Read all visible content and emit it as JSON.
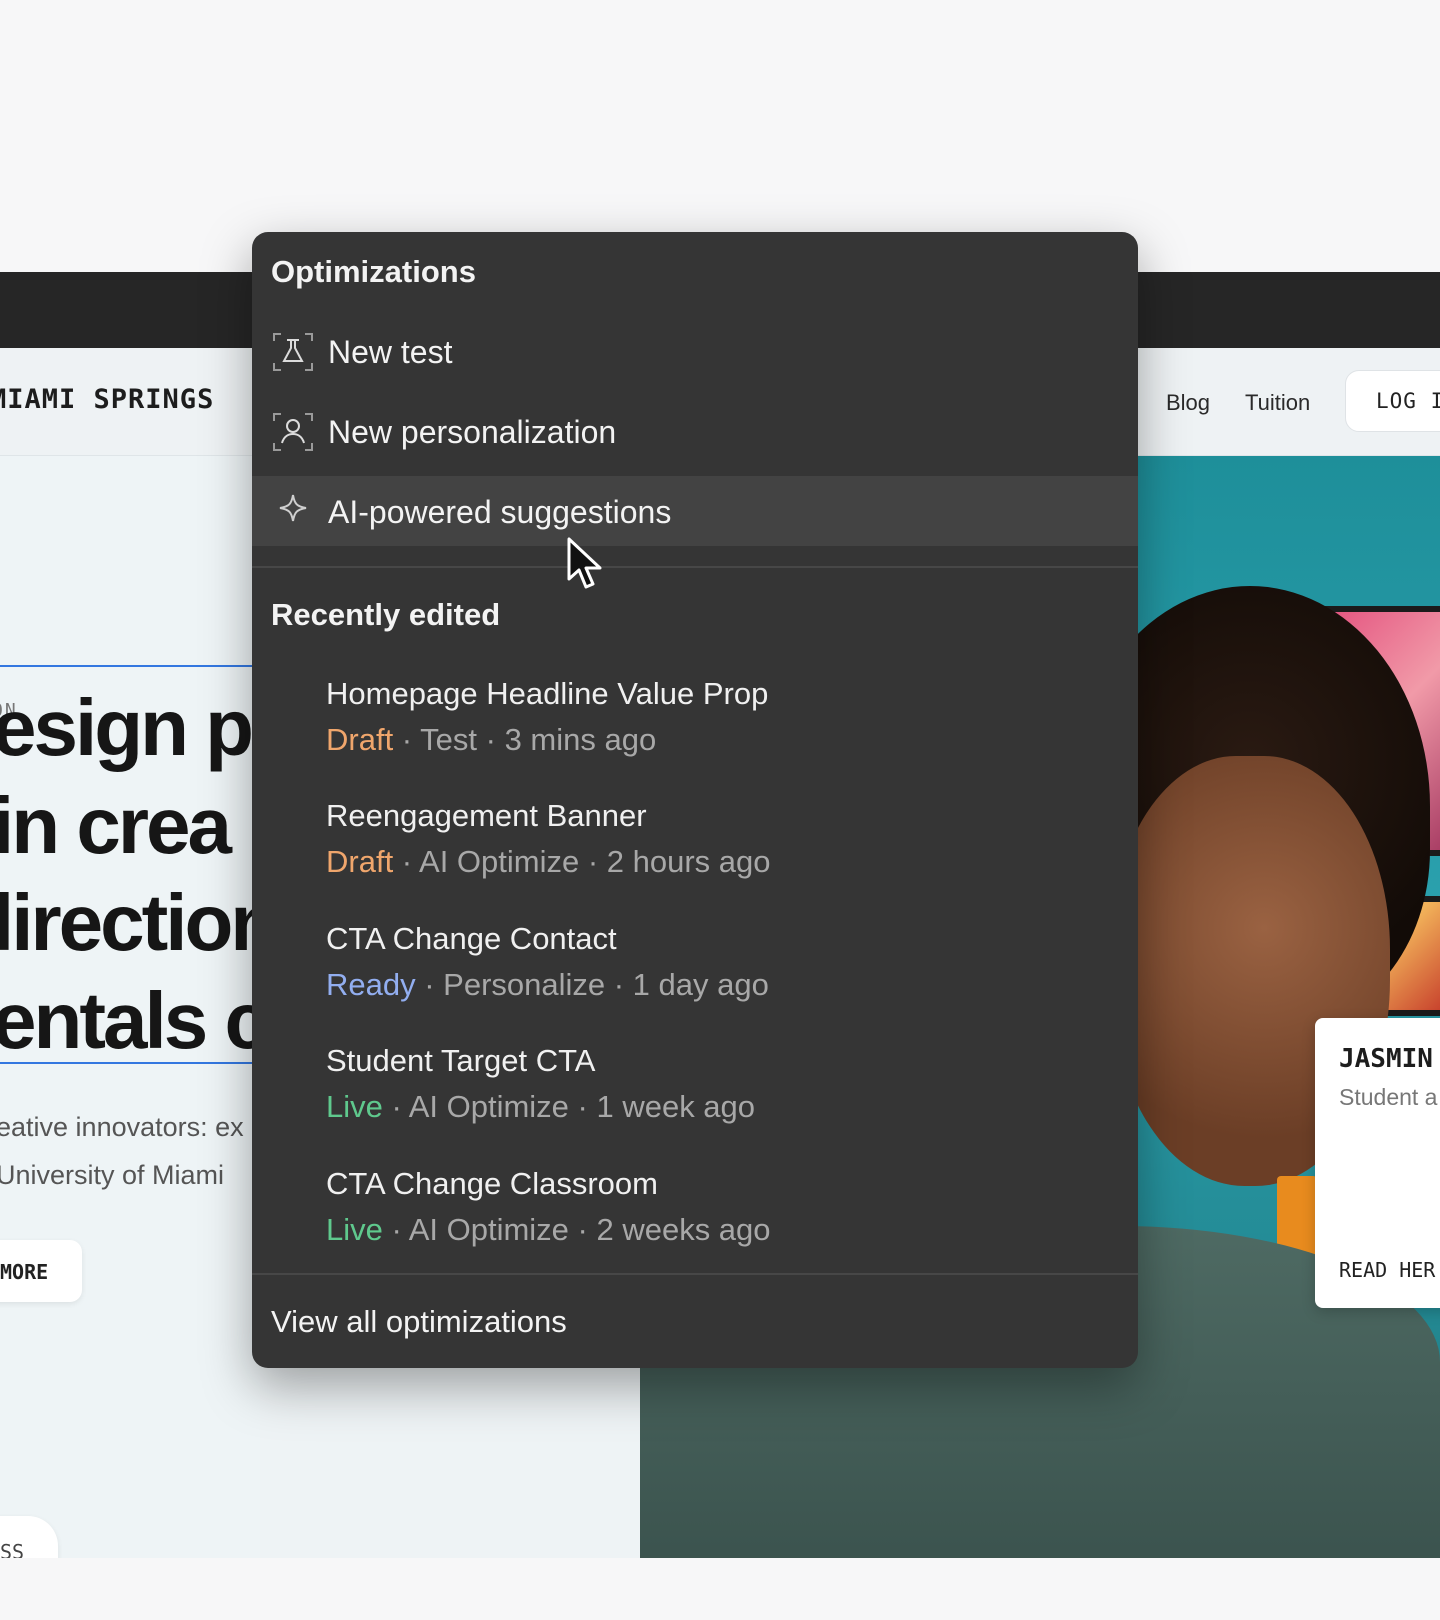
{
  "site": {
    "brand": "MIAMI SPRINGS",
    "nav": {
      "blog": "Blog",
      "tuition": "Tuition",
      "login": "LOG I"
    },
    "eyebrow": "ON",
    "headline_lines": [
      "esign p",
      "in crea",
      "lirection",
      "entals c"
    ],
    "lead_lines": [
      "eative innovators: ex",
      "University of Miami"
    ],
    "more_button": "MORE",
    "bottom_button": "SS",
    "card": {
      "name": "JASMIN",
      "role": "Student a",
      "cta": "READ HER"
    }
  },
  "panel": {
    "title": "Optimizations",
    "actions": [
      {
        "label": "New test",
        "icon": "flask-icon"
      },
      {
        "label": "New personalization",
        "icon": "user-icon"
      },
      {
        "label": "AI-powered suggestions",
        "icon": "sparkle-icon"
      }
    ],
    "recent_title": "Recently edited",
    "recent": [
      {
        "title": "Homepage Headline Value Prop",
        "status": "Draft",
        "meta": " · Test · 3 mins ago"
      },
      {
        "title": "Reengagement Banner",
        "status": "Draft",
        "meta": " · AI Optimize · 2 hours ago"
      },
      {
        "title": "CTA Change Contact",
        "status": "Ready",
        "meta": " · Personalize · 1 day ago"
      },
      {
        "title": "Student Target CTA",
        "status": "Live",
        "meta": " ·  AI Optimize · 1 week ago"
      },
      {
        "title": "CTA Change Classroom",
        "status": "Live",
        "meta": " · AI Optimize · 2 weeks ago"
      }
    ],
    "view_all": "View all optimizations"
  },
  "colors": {
    "panel_bg": "#353535",
    "draft": "#f0a66c",
    "ready": "#92aef0",
    "live": "#5fc98d",
    "topbar": "#262626"
  }
}
